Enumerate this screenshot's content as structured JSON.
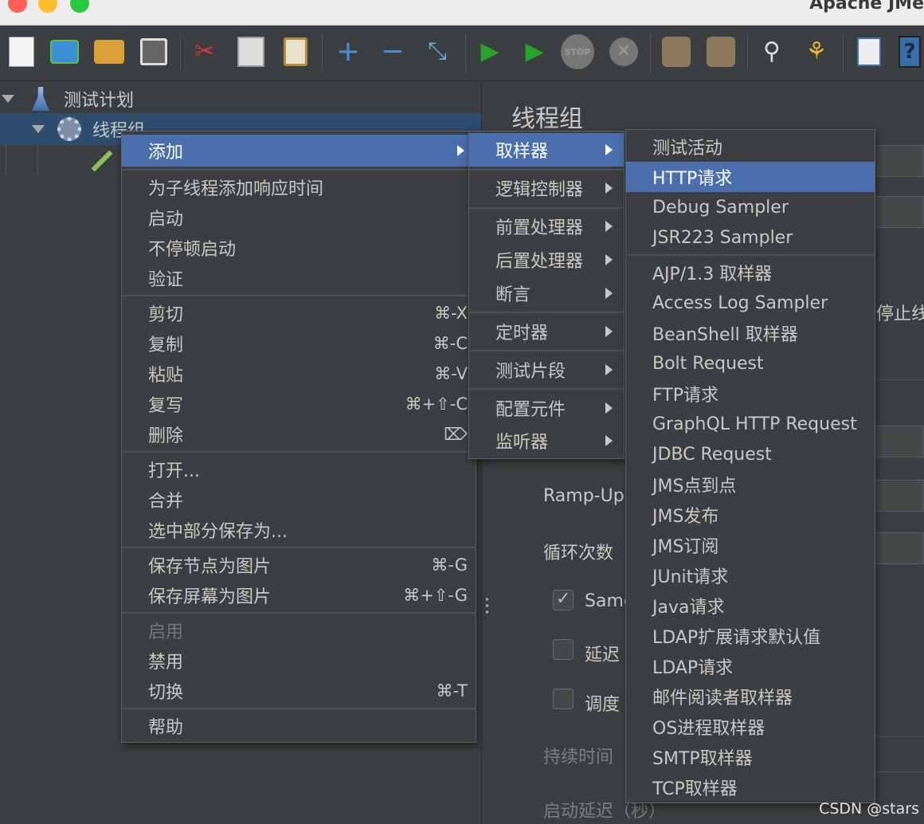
{
  "window": {
    "title": "Apache JMe"
  },
  "tree": {
    "root_label": "测试计划",
    "thread_group_label": "线程组"
  },
  "right_panel": {
    "title": "线程组",
    "stop_label": "停止线",
    "rampup_label": "Ramp-Up",
    "loop_label": "循环次数",
    "same_label": "Same",
    "delay_label": "延迟",
    "scheduler_label": "调度",
    "duration_label": "持续时间",
    "startup_delay_label": "启动延迟（秒）"
  },
  "context_menu": {
    "add": "添加",
    "add_response_time": "为子线程添加响应时间",
    "start": "启动",
    "start_no_pause": "不停顿启动",
    "validate": "验证",
    "cut": "剪切",
    "cut_sc": "⌘-X",
    "copy": "复制",
    "copy_sc": "⌘-C",
    "paste": "粘贴",
    "paste_sc": "⌘-V",
    "duplicate": "复写",
    "duplicate_sc": "⌘+⇧-C",
    "delete": "删除",
    "delete_sc": "⌦",
    "open": "打开...",
    "merge": "合并",
    "save_selection": "选中部分保存为...",
    "save_node_image": "保存节点为图片",
    "save_node_image_sc": "⌘-G",
    "save_screen_image": "保存屏幕为图片",
    "save_screen_image_sc": "⌘+⇧-G",
    "enable": "启用",
    "disable": "禁用",
    "toggle": "切换",
    "toggle_sc": "⌘-T",
    "help": "帮助"
  },
  "add_menu": {
    "items": [
      "取样器",
      "逻辑控制器",
      "前置处理器",
      "后置处理器",
      "断言",
      "定时器",
      "测试片段",
      "配置元件",
      "监听器"
    ]
  },
  "sampler_menu": {
    "items": [
      "测试活动",
      "HTTP请求",
      "Debug Sampler",
      "JSR223 Sampler",
      "AJP/1.3 取样器",
      "Access Log Sampler",
      "BeanShell 取样器",
      "Bolt Request",
      "FTP请求",
      "GraphQL HTTP Request",
      "JDBC Request",
      "JMS点到点",
      "JMS发布",
      "JMS订阅",
      "JUnit请求",
      "Java请求",
      "LDAP扩展请求默认值",
      "LDAP请求",
      "邮件阅读者取样器",
      "OS进程取样器",
      "SMTP取样器",
      "TCP取样器"
    ]
  },
  "watermark": "CSDN @stars"
}
